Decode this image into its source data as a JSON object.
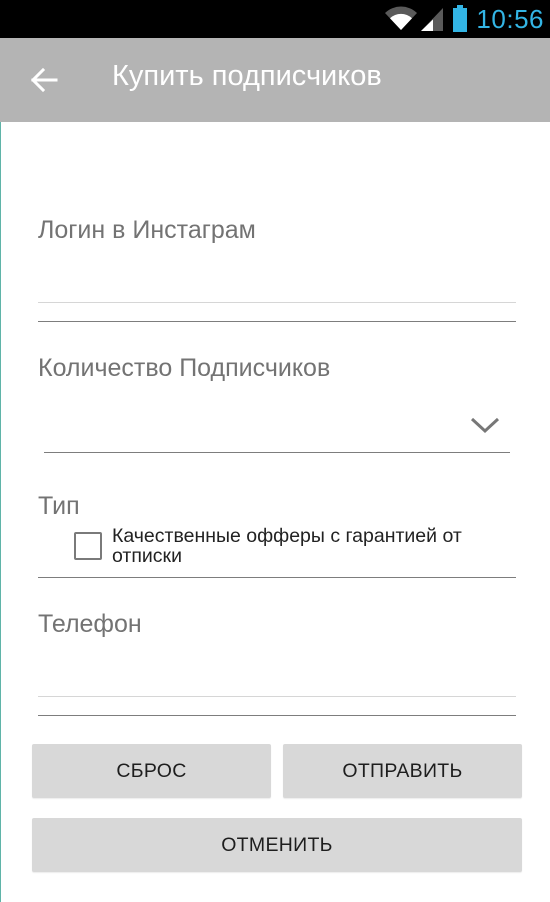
{
  "status_bar": {
    "time": "10:56",
    "icons": [
      "wifi-icon",
      "signal-icon",
      "battery-icon"
    ],
    "time_color": "#33b5e5"
  },
  "app_bar": {
    "back_icon": "arrow-left-icon",
    "title": "Купить подписчиков",
    "background": "#b4b4b4"
  },
  "form": {
    "login": {
      "label": "Логин в Инстаграм",
      "value": ""
    },
    "followers_count": {
      "label": "Количество Подписчиков",
      "selected": "",
      "icon": "chevron-down-icon"
    },
    "type": {
      "label": "Тип",
      "option_label": "Качественные офферы с гарантией от отписки",
      "checked": false
    },
    "phone": {
      "label": "Телефон",
      "value": ""
    }
  },
  "buttons": {
    "reset": "СБРОС",
    "submit": "ОТПРАВИТЬ",
    "cancel": "ОТМЕНИТЬ"
  }
}
